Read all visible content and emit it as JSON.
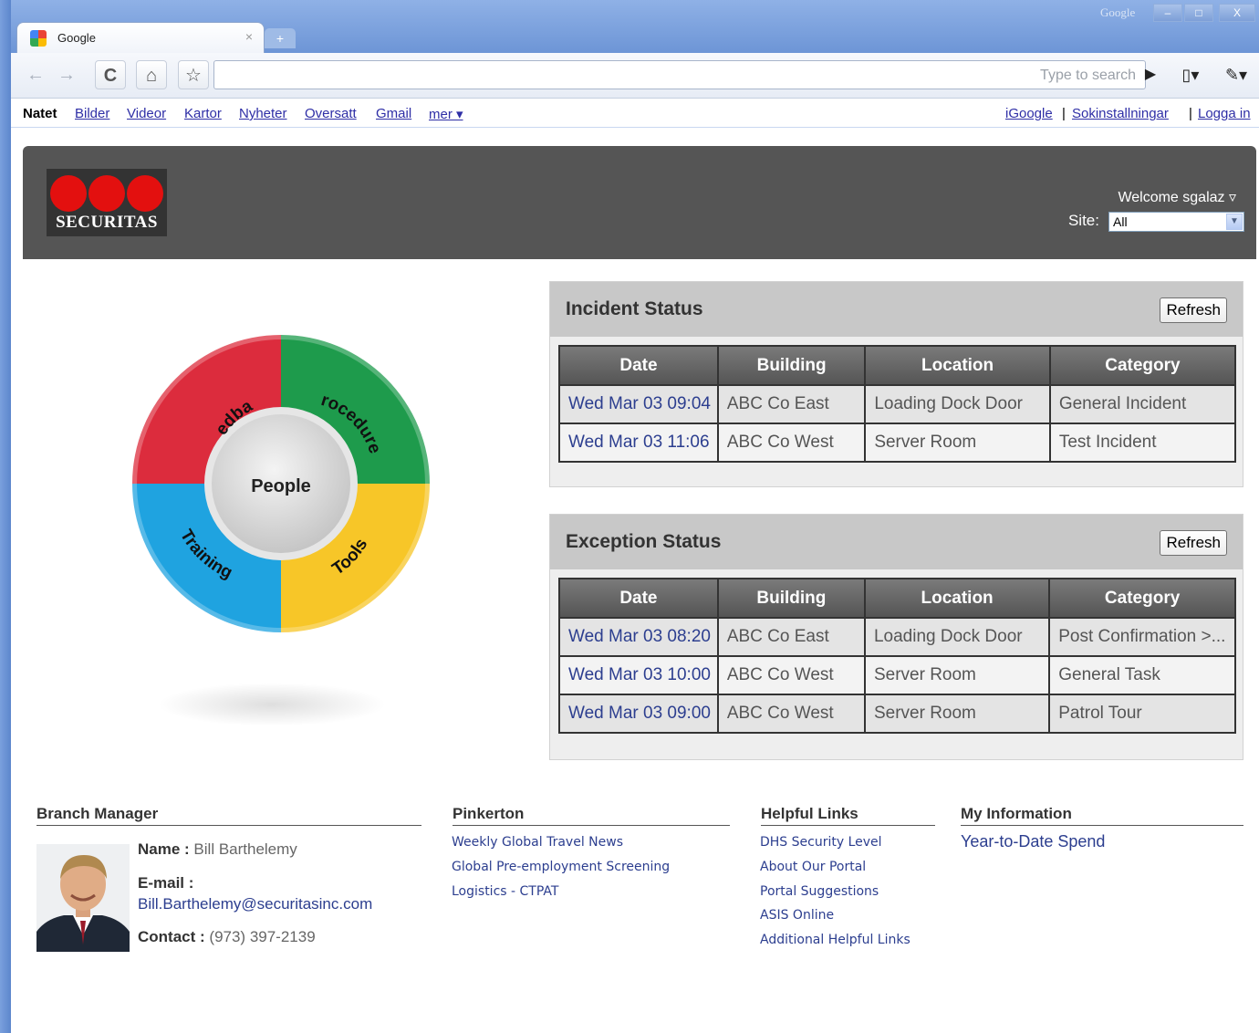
{
  "browser": {
    "tab_title": "Google",
    "tab_close": "×",
    "new_tab": "+",
    "window_brand": "Google",
    "window_controls": {
      "minimize": "–",
      "maximize": "□",
      "close": "X"
    },
    "search_placeholder": "Type to search",
    "icons": [
      "back-icon",
      "forward-icon",
      "reload-icon",
      "home-icon",
      "star-icon",
      "go-icon",
      "page-menu-icon",
      "wrench-icon"
    ]
  },
  "google_bar": {
    "current": "Natet",
    "links": [
      "Bilder",
      "Videor",
      "Kartor",
      "Nyheter",
      "Oversatt",
      "Gmail",
      "mer ▾"
    ],
    "right_links": [
      "iGoogle",
      "Sokinstallningar",
      "Logga in"
    ]
  },
  "header": {
    "logo_text": "SECURITAS",
    "welcome": "Welcome sgalaz ▿",
    "site_label": "Site:",
    "site_value": "All"
  },
  "wheel": {
    "center": "People",
    "segments": [
      {
        "label": "Feedback",
        "color": "#dc2c3d"
      },
      {
        "label": "Procedures",
        "color": "#1e9b4c"
      },
      {
        "label": "Tools",
        "color": "#f7c628"
      },
      {
        "label": "Training",
        "color": "#1fa3e0"
      }
    ]
  },
  "incident": {
    "title": "Incident Status",
    "refresh": "Refresh",
    "columns": [
      "Date",
      "Building",
      "Location",
      "Category"
    ],
    "rows": [
      [
        "Wed Mar 03 09:04",
        "ABC Co East",
        "Loading Dock Door",
        "General Incident"
      ],
      [
        "Wed Mar 03 11:06",
        "ABC Co West",
        "Server Room",
        "Test Incident"
      ]
    ]
  },
  "exception": {
    "title": "Exception Status",
    "refresh": "Refresh",
    "columns": [
      "Date",
      "Building",
      "Location",
      "Category"
    ],
    "rows": [
      [
        "Wed Mar 03 08:20",
        "ABC Co East",
        "Loading Dock Door",
        "Post Confirmation >..."
      ],
      [
        "Wed Mar 03 10:00",
        "ABC Co West",
        "Server Room",
        "General Task"
      ],
      [
        "Wed Mar 03 09:00",
        "ABC Co West",
        "Server Room",
        "Patrol Tour"
      ]
    ]
  },
  "branch_manager": {
    "title": "Branch Manager",
    "name_label": "Name :",
    "name": "Bill Barthelemy",
    "email_label": "E-mail :",
    "email": "Bill.Barthelemy@securitasinc.com",
    "contact_label": "Contact :",
    "contact": "(973) 397-2139"
  },
  "pinkerton": {
    "title": "Pinkerton",
    "links": [
      "Weekly Global Travel News",
      "Global Pre-employment Screening",
      "Logistics - CTPAT"
    ]
  },
  "helpful_links": {
    "title": "Helpful Links",
    "links": [
      "DHS Security Level",
      "About Our Portal",
      "Portal Suggestions",
      "ASIS Online",
      "Additional Helpful Links"
    ]
  },
  "my_information": {
    "title": "My Information",
    "links": [
      "Year-to-Date Spend"
    ]
  }
}
